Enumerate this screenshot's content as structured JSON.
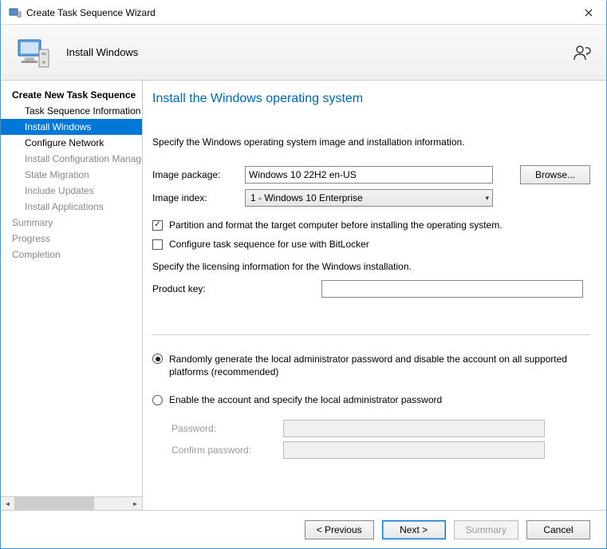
{
  "titlebar": {
    "title": "Create Task Sequence Wizard"
  },
  "header": {
    "title": "Install Windows"
  },
  "sidebar": {
    "items": [
      {
        "label": "Create New Task Sequence",
        "indent": 0,
        "bold": true
      },
      {
        "label": "Task Sequence Information",
        "indent": 1
      },
      {
        "label": "Install Windows",
        "indent": 1,
        "selected": true
      },
      {
        "label": "Configure Network",
        "indent": 1
      },
      {
        "label": "Install Configuration Manager",
        "indent": 1,
        "disabled": true
      },
      {
        "label": "State Migration",
        "indent": 1,
        "disabled": true
      },
      {
        "label": "Include Updates",
        "indent": 1,
        "disabled": true
      },
      {
        "label": "Install Applications",
        "indent": 1,
        "disabled": true
      },
      {
        "label": "Summary",
        "indent": 0,
        "disabled": true
      },
      {
        "label": "Progress",
        "indent": 0,
        "disabled": true
      },
      {
        "label": "Completion",
        "indent": 0,
        "disabled": true
      }
    ]
  },
  "page": {
    "heading": "Install the Windows operating system",
    "intro": "Specify the Windows operating system image and installation information.",
    "image_package_label": "Image package:",
    "image_package_value": "Windows 10 22H2 en-US",
    "browse_label": "Browse...",
    "image_index_label": "Image index:",
    "image_index_value": "1 - Windows 10 Enterprise",
    "cb_partition_label": "Partition and format the target computer before installing the operating system.",
    "cb_bitlocker_label": "Configure task sequence for use with BitLocker",
    "license_intro": "Specify the licensing information for the Windows installation.",
    "productkey_label": "Product key:",
    "productkey_value": "",
    "radio_random_label": "Randomly generate the local administrator password and disable the account on all supported platforms (recommended)",
    "radio_enable_label": "Enable the account and specify the local administrator password",
    "password_label": "Password:",
    "confirm_label": "Confirm password:"
  },
  "footer": {
    "prev": "< Previous",
    "next": "Next >",
    "summary": "Summary",
    "cancel": "Cancel"
  }
}
